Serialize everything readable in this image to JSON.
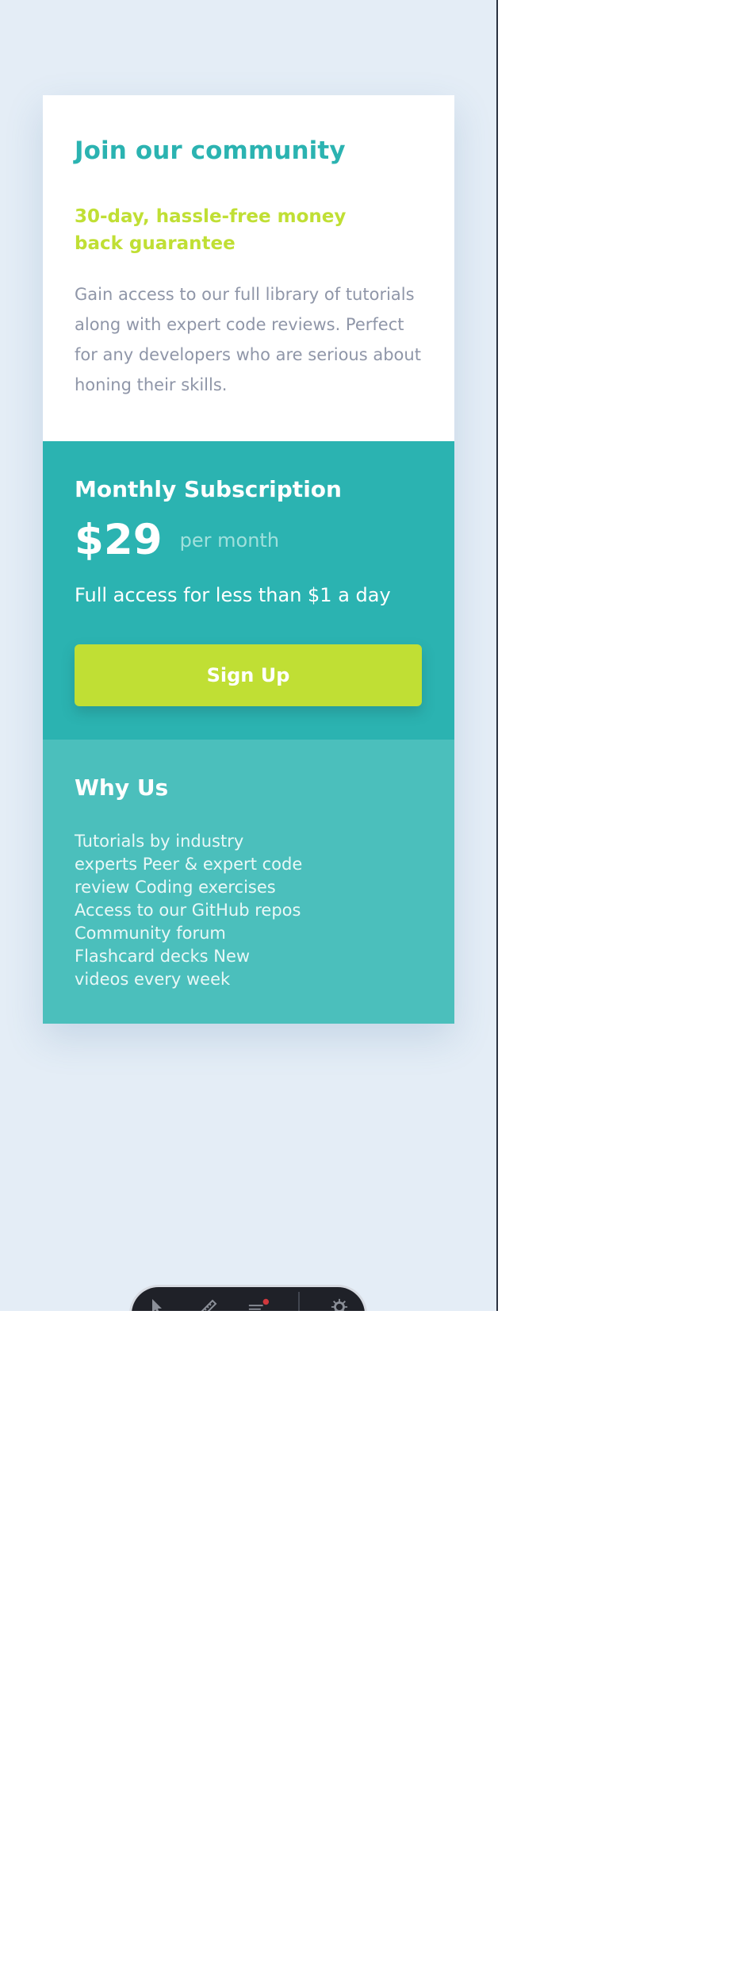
{
  "card": {
    "title": "Join our community",
    "guarantee": "30-day, hassle-free money back guarantee",
    "description": "Gain access to our full library of tutorials along with expert code reviews. Perfect for any developers who are serious about honing their skills."
  },
  "subscription": {
    "title": "Monthly Subscription",
    "price": "$29",
    "period": "per month",
    "tagline": "Full access for less than $1 a day",
    "button_label": "Sign Up"
  },
  "why_us": {
    "title": "Why Us",
    "body": "Tutorials by industry experts Peer & expert code review Coding exercises Access to our GitHub repos Community forum Flashcard decks New videos every week"
  },
  "colors": {
    "background": "#e4edf6",
    "cyan": "#2bb3b1",
    "light_cyan": "#4bbfbc",
    "lime": "#c0df34",
    "grey_text": "#8f96a8",
    "toolbar": "#1f2128"
  },
  "toolbar": {
    "icons": [
      "inspect-icon",
      "ruler-icon",
      "layers-icon",
      "settings-icon"
    ]
  }
}
